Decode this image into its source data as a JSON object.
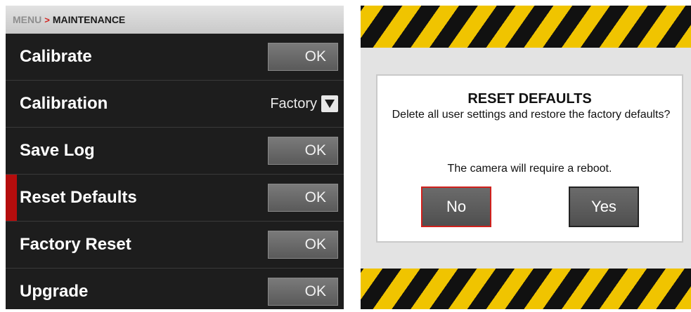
{
  "menu": {
    "breadcrumb": {
      "root": "MENU",
      "separator": ">",
      "current": "MAINTENANCE"
    },
    "items": [
      {
        "label": "Calibrate",
        "control": "button",
        "button_label": "OK"
      },
      {
        "label": "Calibration",
        "control": "select",
        "selected_value": "Factory"
      },
      {
        "label": "Save Log",
        "control": "button",
        "button_label": "OK"
      },
      {
        "label": "Reset Defaults",
        "control": "button",
        "button_label": "OK",
        "active": true
      },
      {
        "label": "Factory Reset",
        "control": "button",
        "button_label": "OK"
      },
      {
        "label": "Upgrade",
        "control": "button",
        "button_label": "OK"
      }
    ]
  },
  "dialog": {
    "title": "RESET DEFAULTS",
    "message": "Delete all user settings and restore the factory defaults?",
    "note": "The camera will require a reboot.",
    "buttons": {
      "no": "No",
      "yes": "Yes"
    }
  },
  "colors": {
    "accent_red": "#d0211d",
    "hazard_yellow": "#f0c400",
    "hazard_black": "#111111",
    "menu_background": "#1d1d1d"
  }
}
